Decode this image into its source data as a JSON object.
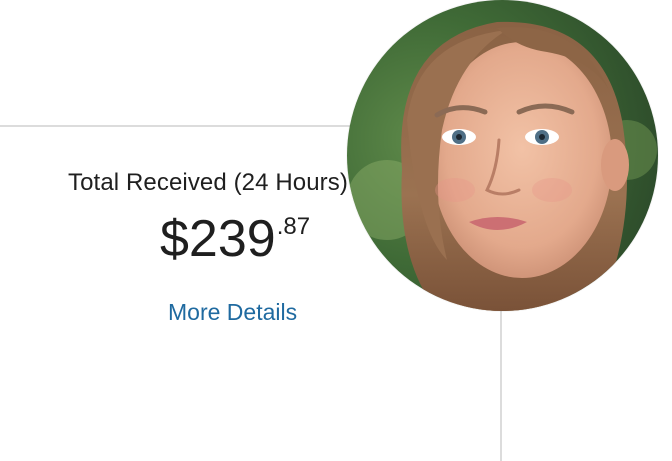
{
  "card": {
    "title": "Total Received (24 Hours)",
    "amount": {
      "currency": "$",
      "whole": "239",
      "cents": ".87"
    },
    "link_label": "More Details"
  },
  "avatar": {
    "description_icon": "user-photo"
  },
  "colors": {
    "link": "#1f6aa0",
    "text": "#1f1f1f",
    "border": "#dcdcdc"
  }
}
